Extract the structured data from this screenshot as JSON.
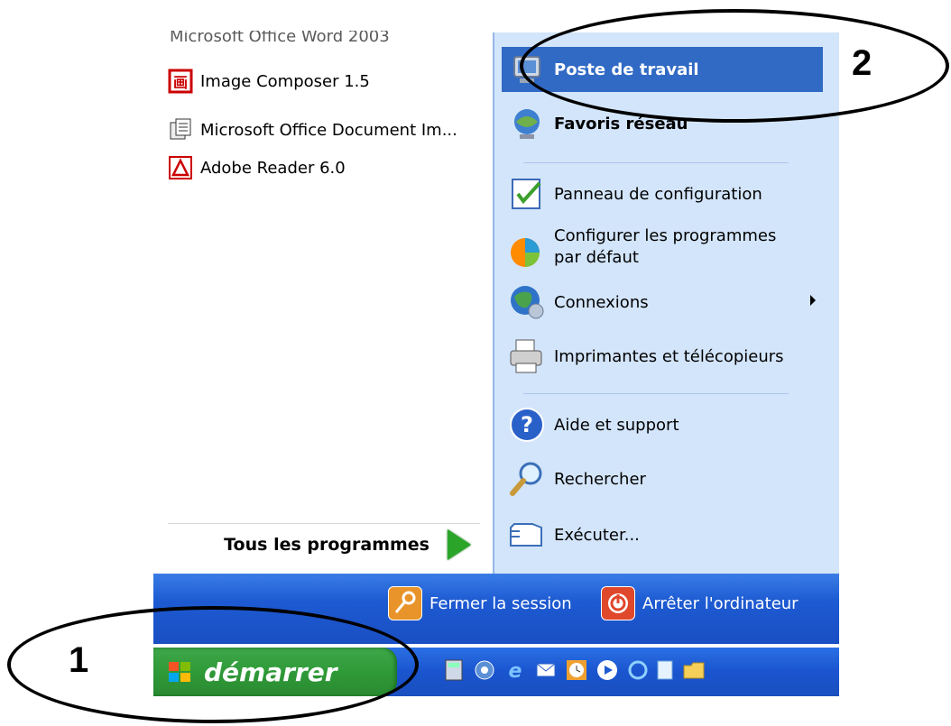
{
  "start_menu": {
    "partial_top_item": "Microsoft Office Word 2003",
    "left_items": [
      {
        "label": "Image Composer 1.5",
        "icon": "image-composer-icon"
      },
      {
        "label": "Microsoft Office Document Im...",
        "icon": "document-imaging-icon"
      },
      {
        "label": "Adobe Reader 6.0",
        "icon": "adobe-reader-icon"
      }
    ],
    "all_programs": "Tous les programmes",
    "right_items": {
      "poste": "Poste de travail",
      "favoris": "Favoris réseau",
      "panneau": "Panneau de configuration",
      "configurer_1": "Configurer les programmes",
      "configurer_2": "par défaut",
      "connexions": "Connexions",
      "imprimantes": "Imprimantes et télécopieurs",
      "aide": "Aide et support",
      "rechercher": "Rechercher",
      "executer": "Exécuter..."
    },
    "logoff": "Fermer la session",
    "shutdown": "Arrêter l'ordinateur"
  },
  "taskbar": {
    "start_label": "démarrer",
    "quick_launch_icons": [
      "calculator-icon",
      "gear-app-icon",
      "internet-explorer-icon",
      "outlook-icon",
      "clock-icon",
      "media-player-icon",
      "search-icon",
      "notepad-icon",
      "folder-icon"
    ]
  },
  "annotations": {
    "label_1": "1",
    "label_2": "2"
  },
  "colors": {
    "highlight": "#316ac5",
    "right_pane": "#d3e5fa",
    "start_green": "#2f9a38",
    "taskbar_blue": "#1a55cf"
  }
}
